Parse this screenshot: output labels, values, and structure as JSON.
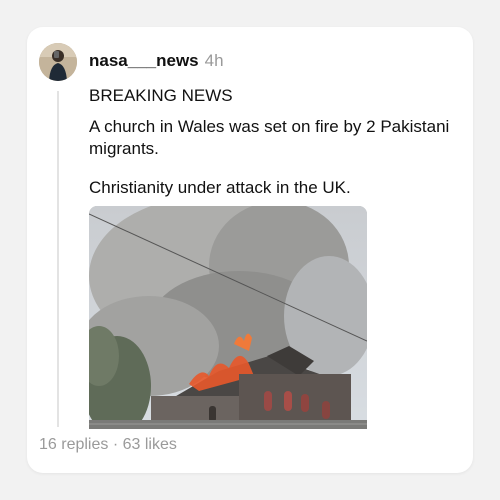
{
  "post": {
    "username": "nasa___news",
    "time": "4h",
    "lines": [
      "BREAKING NEWS",
      "A church in Wales was set on fire by 2 Pakistani migrants.",
      "Christianity under attack in the UK."
    ],
    "replies": "16 replies",
    "separator": " · ",
    "likes": "63 likes"
  },
  "icons": {
    "avatar": "user-avatar-photo",
    "photo": "burning-church-photo"
  },
  "colors": {
    "background": "#f2f2f2",
    "card": "#ffffff",
    "text": "#111111",
    "muted": "#9a9a9a",
    "fire": "#e8582a"
  }
}
